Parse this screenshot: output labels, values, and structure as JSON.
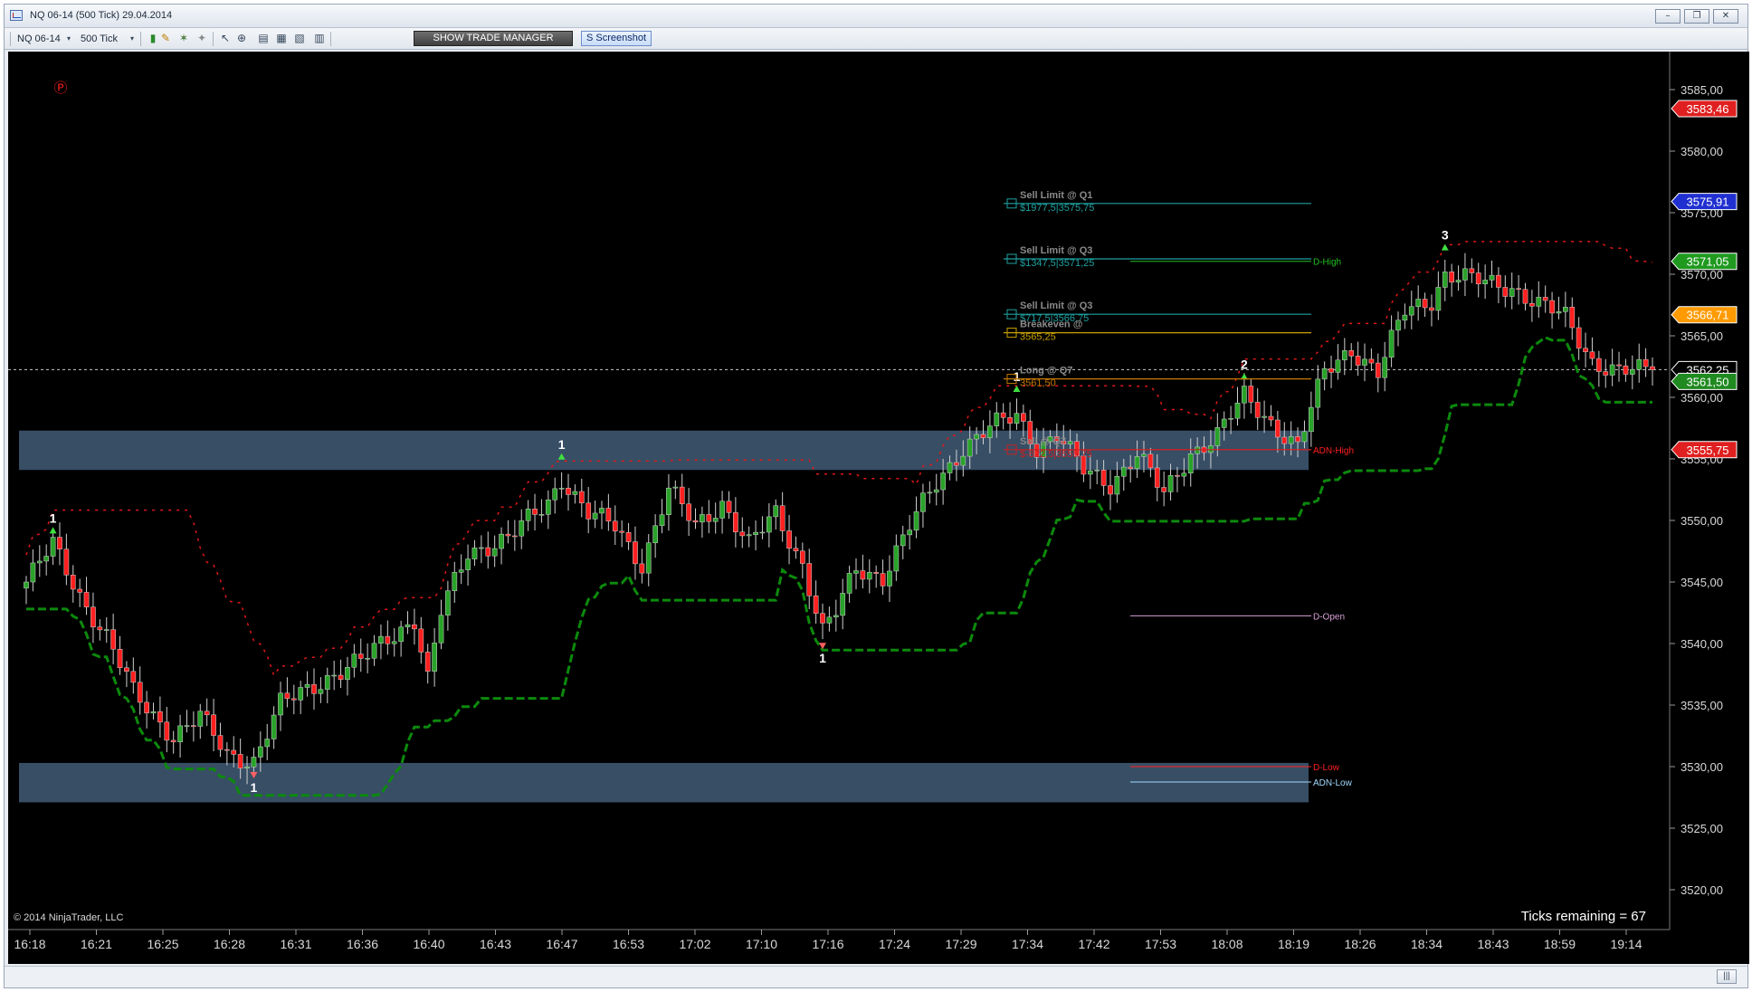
{
  "window": {
    "title": "NQ 06-14 (500 Tick)  29.04.2014",
    "controls": [
      "–",
      "❐",
      "✕"
    ]
  },
  "toolbar": {
    "instrument": "NQ 06-14",
    "interval": "500 Tick",
    "trade_manager_label": "SHOW TRADE MANAGER",
    "screenshot_label": "S Screenshot"
  },
  "colors": {
    "background": "#000000",
    "bull_candle": "#29a329",
    "bear_candle": "#ff2020",
    "zone": "#3d5670",
    "trail_green": "#0c8a0c",
    "trail_red": "#e01818"
  },
  "chart_data": {
    "type": "candlestick",
    "instrument": "NQ 06-14",
    "interval": "500 Tick",
    "date": "29.04.2014",
    "ylim": [
      3517.5,
      3587.5
    ],
    "y_ticks": [
      3520,
      3525,
      3530,
      3535,
      3540,
      3545,
      3550,
      3555,
      3560,
      3565,
      3570,
      3575,
      3580,
      3585
    ],
    "y_tick_labels": [
      "3520,00",
      "3525,00",
      "3530,00",
      "3535,00",
      "3540,00",
      "3545,00",
      "3550,00",
      "3555,00",
      "3560,00",
      "3565,00",
      "3570,00",
      "3575,00",
      "3580,00",
      "3585,00"
    ],
    "x_tick_labels": [
      "16:18",
      "16:21",
      "16:25",
      "16:28",
      "16:31",
      "16:36",
      "16:40",
      "16:43",
      "16:47",
      "16:53",
      "17:02",
      "17:10",
      "17:16",
      "17:24",
      "17:29",
      "17:34",
      "17:42",
      "17:53",
      "18:08",
      "18:19",
      "18:26",
      "18:34",
      "18:43",
      "18:59",
      "19:14"
    ],
    "bar_count": 244,
    "price_path": [
      [
        0,
        3545.0
      ],
      [
        4,
        3548.0
      ],
      [
        8,
        3544.0
      ],
      [
        12,
        3540.5
      ],
      [
        16,
        3536.0
      ],
      [
        22,
        3532.5
      ],
      [
        26,
        3534.0
      ],
      [
        30,
        3531.0
      ],
      [
        34,
        3530.5
      ],
      [
        38,
        3535.0
      ],
      [
        44,
        3537.0
      ],
      [
        50,
        3538.5
      ],
      [
        54,
        3540.5
      ],
      [
        58,
        3542.0
      ],
      [
        60,
        3537.0
      ],
      [
        62,
        3542.5
      ],
      [
        66,
        3547.5
      ],
      [
        72,
        3548.5
      ],
      [
        78,
        3551.5
      ],
      [
        80,
        3553.5
      ],
      [
        84,
        3550.5
      ],
      [
        88,
        3549.5
      ],
      [
        92,
        3546.5
      ],
      [
        96,
        3552.5
      ],
      [
        100,
        3549.5
      ],
      [
        104,
        3551.5
      ],
      [
        108,
        3548.0
      ],
      [
        112,
        3550.5
      ],
      [
        116,
        3546.5
      ],
      [
        119,
        3541.0
      ],
      [
        121,
        3542.5
      ],
      [
        124,
        3546.0
      ],
      [
        128,
        3545.5
      ],
      [
        132,
        3549.5
      ],
      [
        136,
        3553.0
      ],
      [
        140,
        3556.0
      ],
      [
        144,
        3557.5
      ],
      [
        148,
        3558.5
      ],
      [
        151,
        3556.0
      ],
      [
        154,
        3557.0
      ],
      [
        158,
        3554.0
      ],
      [
        162,
        3553.0
      ],
      [
        166,
        3555.5
      ],
      [
        170,
        3552.0
      ],
      [
        174,
        3555.5
      ],
      [
        178,
        3557.0
      ],
      [
        182,
        3560.0
      ],
      [
        186,
        3558.0
      ],
      [
        190,
        3556.0
      ],
      [
        194,
        3562.0
      ],
      [
        198,
        3564.0
      ],
      [
        202,
        3562.0
      ],
      [
        206,
        3567.0
      ],
      [
        210,
        3568.0
      ],
      [
        212,
        3570.0
      ],
      [
        216,
        3569.5
      ],
      [
        222,
        3569.0
      ],
      [
        226,
        3567.5
      ],
      [
        230,
        3566.5
      ],
      [
        234,
        3563.0
      ],
      [
        238,
        3562.0
      ],
      [
        243,
        3562.25
      ]
    ],
    "horizontal_levels": [
      {
        "label": "D-High",
        "price": 3571.05,
        "color": "#20c020",
        "tag": "3571,05"
      },
      {
        "label": "ADN-High",
        "price": 3555.75,
        "color": "#ff2020",
        "tag": "3555,75"
      },
      {
        "label": "D-Open",
        "price": 3542.25,
        "color": "#d8a0d8"
      },
      {
        "label": "D-Low",
        "price": 3530.0,
        "color": "#ff2020"
      },
      {
        "label": "ADN-Low",
        "price": 3528.75,
        "color": "#a0d8ff"
      }
    ],
    "price_tags": [
      {
        "value": "3583,46",
        "price": 3583.46,
        "color": "#e02020"
      },
      {
        "value": "3575,91",
        "price": 3575.91,
        "color": "#2030d0"
      },
      {
        "value": "3571,05",
        "price": 3571.05,
        "color": "#1f9a1f"
      },
      {
        "value": "3566,71",
        "price": 3566.71,
        "color": "#ff9a00"
      },
      {
        "value": "3562,25",
        "price": 3562.25,
        "color": "#000000"
      },
      {
        "value": "3561,50",
        "price": 3561.3,
        "color": "#1f8a1f"
      },
      {
        "value": "3555,75",
        "price": 3555.75,
        "color": "#e02020"
      }
    ],
    "orders": [
      {
        "label": "Sell Limit @ Q1",
        "pnl": "$1977,5",
        "price_text": "3575,75",
        "price": 3575.75,
        "color": "#1fa0a0"
      },
      {
        "label": "Sell Limit @ Q3",
        "pnl": "$1347,5",
        "price_text": "3571,25",
        "price": 3571.25,
        "color": "#1fa0a0"
      },
      {
        "label": "Sell Limit @ Q3",
        "pnl": "$717,5",
        "price_text": "3566,75",
        "price": 3566.75,
        "color": "#1fa0a0"
      },
      {
        "label": "Breakeven @ ",
        "pnl": "",
        "price_text": "3565,25",
        "price": 3565.25,
        "color": "#c8a000"
      },
      {
        "label": "Long @ Q7",
        "pnl": "",
        "price_text": "3561,50",
        "price": 3561.5,
        "color": "#c87a00"
      },
      {
        "label": "Sell @ Q7",
        "pnl": "$-822,5",
        "price_text": "3555,75",
        "price": 3555.75,
        "color": "#c82020"
      }
    ],
    "swing_labels": [
      {
        "text": "1",
        "bar": 4,
        "price": 3548.5,
        "dir": "up"
      },
      {
        "text": "1",
        "bar": 34,
        "price": 3530.0,
        "dir": "down"
      },
      {
        "text": "1",
        "bar": 80,
        "price": 3554.5,
        "dir": "up"
      },
      {
        "text": "1",
        "bar": 119,
        "price": 3540.5,
        "dir": "down"
      },
      {
        "text": "1",
        "bar": 148,
        "price": 3560.0,
        "dir": "up"
      },
      {
        "text": "2",
        "bar": 182,
        "price": 3561.0,
        "dir": "up"
      },
      {
        "text": "3",
        "bar": 212,
        "price": 3571.5,
        "dir": "up"
      }
    ],
    "zones": [
      {
        "top": 3557.3,
        "bottom": 3554.1
      },
      {
        "top": 3530.3,
        "bottom": 3527.1
      }
    ],
    "footer_copyright": "© 2014 NinjaTrader, LLC",
    "ticks_remaining": "Ticks remaining = 67"
  }
}
